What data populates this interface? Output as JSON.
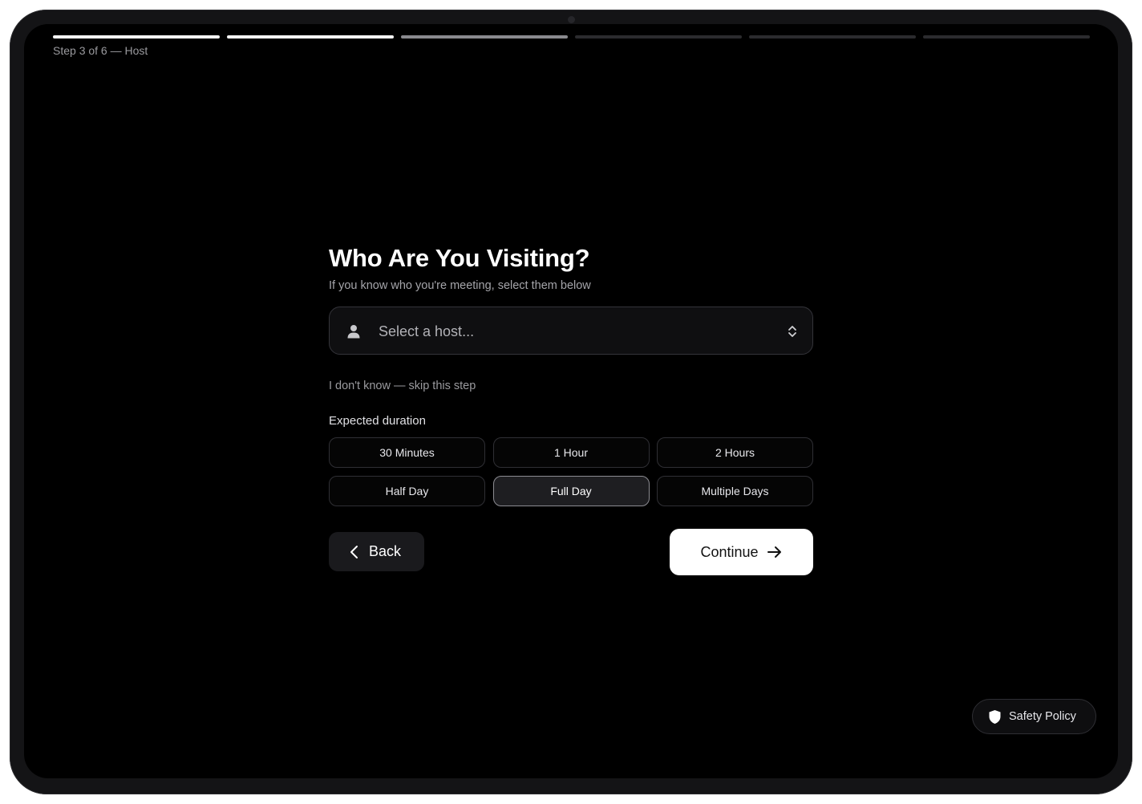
{
  "progress": {
    "step_label": "Step 3 of 6 — Host",
    "segments": [
      "done",
      "done",
      "current",
      "todo",
      "todo",
      "todo"
    ]
  },
  "main": {
    "title": "Who Are You Visiting?",
    "subtitle": "If you know who you're meeting, select them below",
    "host_select": {
      "placeholder": "Select a host...",
      "icon": "user-icon",
      "chevron_icon": "chevron-up-down-icon"
    },
    "skip_link": "I don't know — skip this step",
    "duration": {
      "label": "Expected duration",
      "selected": "Full Day",
      "options": [
        {
          "label": "30 Minutes"
        },
        {
          "label": "1 Hour"
        },
        {
          "label": "2 Hours"
        },
        {
          "label": "Half Day"
        },
        {
          "label": "Full Day"
        },
        {
          "label": "Multiple Days"
        }
      ]
    },
    "back_label": "Back",
    "continue_label": "Continue"
  },
  "safety": {
    "label": "Safety Policy",
    "icon": "shield-icon"
  },
  "colors": {
    "background": "#000000",
    "accent": "#ffffff",
    "progress_done": "#f5f5f5",
    "progress_current": "#8a8a8e",
    "progress_todo": "#2b2b2e"
  }
}
